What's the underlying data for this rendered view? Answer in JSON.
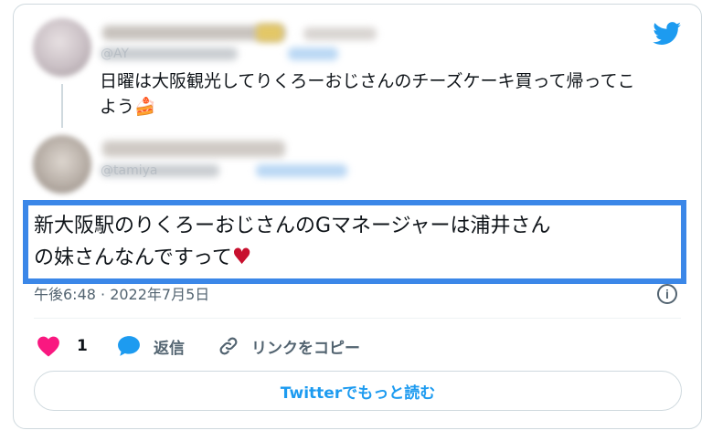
{
  "first_tweet": {
    "handle": "@AY",
    "text_line1": "日曜は大阪観光してりくろーおじさんのチーズケーキ買って帰ってこ",
    "text_line2": "よう",
    "emoji": "🍰"
  },
  "reply_tweet": {
    "handle": "@tamiya",
    "text_line1": "新大阪駅のりくろーおじさんのGマネージャーは浦井さん",
    "text_line2": "の妹さんなんですって",
    "heart_emoji": "♥"
  },
  "timestamp": "午後6:48 · 2022年7月5日",
  "actions": {
    "like_count": "1",
    "reply_label": "返信",
    "copy_link_label": "リンクをコピー"
  },
  "read_more_label": "Twitterでもっと読む",
  "colors": {
    "twitter_blue": "#1d9bf0",
    "highlight_border": "#3b87e8",
    "like_pink": "#f91880",
    "secondary_text": "#536471"
  }
}
